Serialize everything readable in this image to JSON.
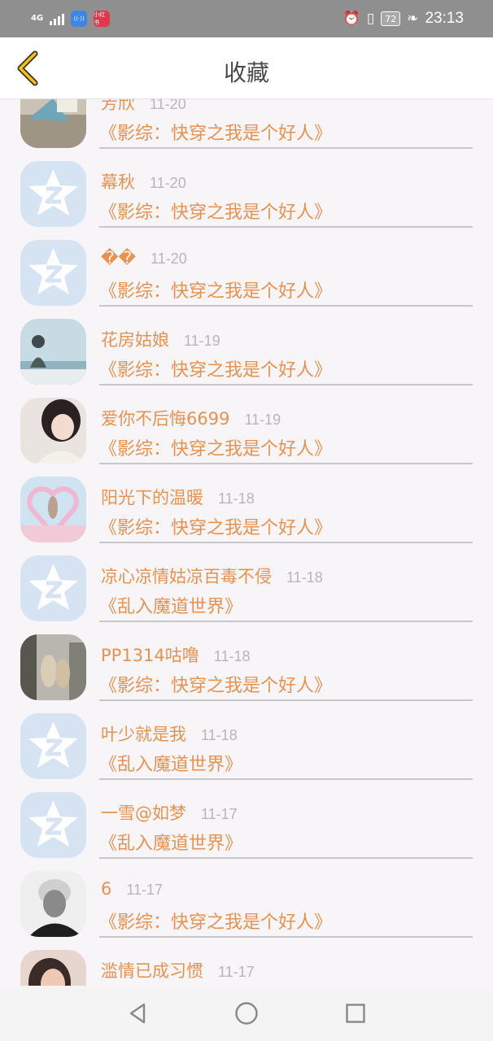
{
  "status_bar": {
    "network": "4G",
    "app_badge_red": "小红书",
    "battery": "72",
    "time": "23:13"
  },
  "header": {
    "title": "收藏"
  },
  "favorites": [
    {
      "name": "芳欣",
      "date": "11-20",
      "book": "《影综：快穿之我是个好人》",
      "avatar": "photo-scenery"
    },
    {
      "name": "幕秋",
      "date": "11-20",
      "book": "《影综：快穿之我是个好人》",
      "avatar": "default-qq"
    },
    {
      "name": "��",
      "date": "11-20",
      "book": "《影综：快穿之我是个好人》",
      "avatar": "default-qq"
    },
    {
      "name": "花房姑娘",
      "date": "11-19",
      "book": "《影综：快穿之我是个好人》",
      "avatar": "photo-seaside"
    },
    {
      "name": "爱你不后悔6699",
      "date": "11-19",
      "book": "《影综：快穿之我是个好人》",
      "avatar": "photo-girl"
    },
    {
      "name": "阳光下的温暖",
      "date": "11-18",
      "book": "《影综：快穿之我是个好人》",
      "avatar": "photo-heart"
    },
    {
      "name": "凉心凉情姑凉百毒不侵",
      "date": "11-18",
      "book": "《乱入魔道世界》",
      "avatar": "default-qq"
    },
    {
      "name": "PP1314咕噜",
      "date": "11-18",
      "book": "《影综：快穿之我是个好人》",
      "avatar": "photo-street"
    },
    {
      "name": "叶少就是我",
      "date": "11-18",
      "book": "《乱入魔道世界》",
      "avatar": "default-qq"
    },
    {
      "name": "一雪@如梦",
      "date": "11-17",
      "book": "《乱入魔道世界》",
      "avatar": "default-qq"
    },
    {
      "name": "6",
      "date": "11-17",
      "book": "《影综：快穿之我是个好人》",
      "avatar": "photo-bw"
    },
    {
      "name": "滥情已成习惯",
      "date": "11-17",
      "book": "",
      "avatar": "photo-woman"
    }
  ],
  "colors": {
    "accent": "#e8924f",
    "date": "#b8b4b8",
    "background": "#f7f5f8"
  },
  "icons": {
    "back": "chevron-left-icon",
    "nav_back": "triangle-back-icon",
    "nav_home": "circle-home-icon",
    "nav_recent": "square-recent-icon"
  }
}
